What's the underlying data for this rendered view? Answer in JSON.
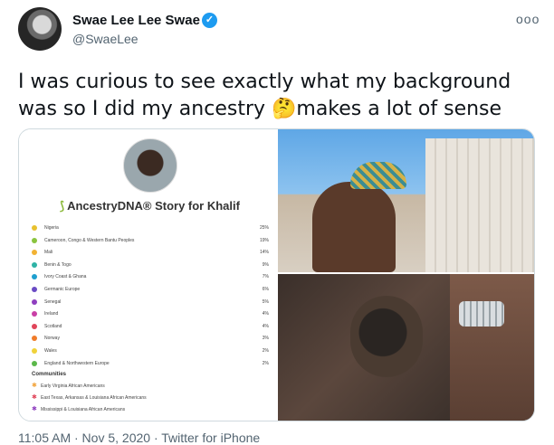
{
  "tweet": {
    "display_name": "Swae Lee Lee Swae",
    "handle": "@SwaeLee",
    "verified_glyph": "✓",
    "more_glyph": "ooo",
    "text": "I was curious to see exactly what my background was so I did my ancestry 🤔makes a lot of sense",
    "meta": "11:05 AM · Nov 5, 2020 · Twitter for iPhone"
  },
  "ancestry": {
    "logo_glyph": "⟆",
    "title": "AncestryDNA® Story for Khalif",
    "ethnicities": [
      {
        "name": "Nigeria",
        "pct": "25%",
        "color": "#e8c12f"
      },
      {
        "name": "Cameroon, Congo & Western Bantu Peoples",
        "pct": "19%",
        "color": "#8ac43f"
      },
      {
        "name": "Mali",
        "pct": "14%",
        "color": "#f2b233"
      },
      {
        "name": "Benin & Togo",
        "pct": "9%",
        "color": "#2fb3a6"
      },
      {
        "name": "Ivory Coast & Ghana",
        "pct": "7%",
        "color": "#1f9fcf"
      },
      {
        "name": "Germanic Europe",
        "pct": "6%",
        "color": "#6a4bc4"
      },
      {
        "name": "Senegal",
        "pct": "5%",
        "color": "#8f3fbf"
      },
      {
        "name": "Ireland",
        "pct": "4%",
        "color": "#c93fa6"
      },
      {
        "name": "Scotland",
        "pct": "4%",
        "color": "#e0455a"
      },
      {
        "name": "Norway",
        "pct": "3%",
        "color": "#f07c2a"
      },
      {
        "name": "Wales",
        "pct": "2%",
        "color": "#f0d23a"
      },
      {
        "name": "England & Northwestern Europe",
        "pct": "2%",
        "color": "#5bb84a"
      }
    ],
    "communities_header": "Communities",
    "communities": [
      {
        "name": "Early Virginia African Americans",
        "color": "#f2a33a"
      },
      {
        "name": "East Texas, Arkansas & Louisiana African Americans",
        "color": "#e0455a"
      },
      {
        "name": "Mississippi & Louisiana African Americans",
        "color": "#8f3fbf"
      }
    ]
  }
}
